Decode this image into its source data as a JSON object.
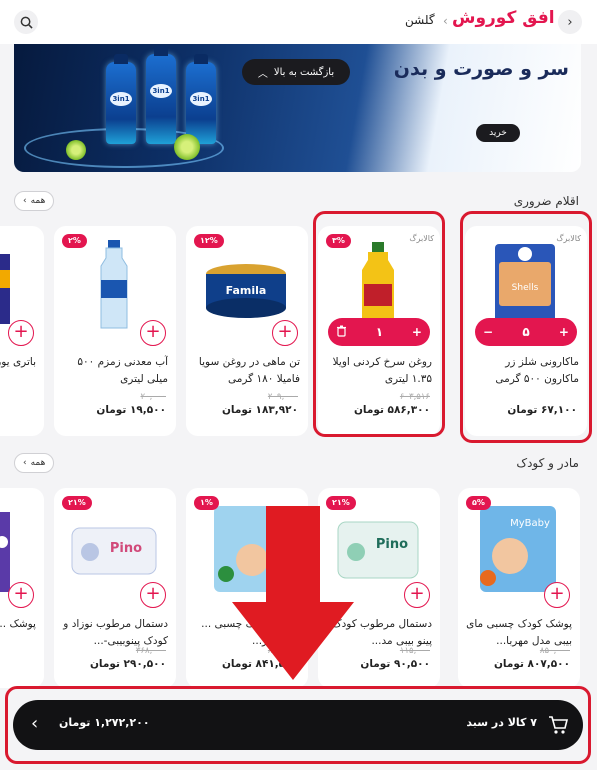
{
  "header": {
    "logo": "افق کوروش",
    "separator": "‹",
    "branch": "گلشن"
  },
  "banner": {
    "headline": "سر و صورت و بدن",
    "back_to_top": "بازگشت به بالا",
    "buy_label": "خرید",
    "bottle_label": "3in1"
  },
  "sections": [
    {
      "title": "اقلام ضروری",
      "all_label": "همه",
      "products": [
        {
          "tag": "کالابرگ",
          "discount": "",
          "name": "ماکارونی شلز زر ماکارون ۵۰۰ گرمی",
          "old_price": "",
          "price": "۶۷,۱۰۰ تومان",
          "qty": "۵",
          "in_cart": true
        },
        {
          "tag": "کالابرگ",
          "discount": "۳%",
          "name": "روغن سرخ کردنی اویلا ۱.۳۵ لیتری",
          "old_price": "۶۰۳,۵۱۶",
          "price": "۵۸۶,۳۰۰ تومان",
          "qty": "۱",
          "in_cart": true
        },
        {
          "tag": "",
          "discount": "۱۲%",
          "name": "تن ماهی در روغن سویا فامیلا ۱۸۰ گرمی",
          "old_price": "۲۰۹,۰۰۰",
          "price": "۱۸۳,۹۲۰ تومان",
          "qty": "",
          "in_cart": false
        },
        {
          "tag": "",
          "discount": "۲%",
          "name": "آب معدنی زمزم ۵۰۰ میلی لیتری",
          "old_price": "۲۰,۰۰۰",
          "price": "۱۹,۵۰۰ تومان",
          "qty": "",
          "in_cart": false
        },
        {
          "tag": "",
          "discount": "",
          "name": "باتری یوروس",
          "old_price": "",
          "price": "",
          "qty": "",
          "in_cart": false
        }
      ]
    },
    {
      "title": "مادر و کودک",
      "all_label": "همه",
      "products": [
        {
          "tag": "",
          "discount": "۵%",
          "name": "پوشک کودک چسبی مای بیبی مدل مهربا...",
          "old_price": "۸۵۰,۰۰۰",
          "price": "۸۰۷,۵۰۰ تومان",
          "qty": "",
          "in_cart": false
        },
        {
          "tag": "",
          "discount": "۲۱%",
          "name": "دستمال مرطوب کودک پینو بیبی مد...",
          "old_price": "۱۱۵,۰۰۰",
          "price": "۹۰,۵۰۰ تومان",
          "qty": "",
          "in_cart": false
        },
        {
          "tag": "",
          "discount": "۱%",
          "name": "پوشک کودک چسبی ... کانال دار...",
          "old_price": "۸۵۰,۰۰۰",
          "price": "۸۴۱,۵۰۰ تومان",
          "qty": "",
          "in_cart": false
        },
        {
          "tag": "",
          "discount": "۲۱%",
          "name": "دستمال مرطوب نوزاد و کودک پینوبیبی-...",
          "old_price": "۳۶۸,۰۰۰",
          "price": "۲۹۰,۵۰۰ تومان",
          "qty": "",
          "in_cart": false
        },
        {
          "tag": "",
          "discount": "",
          "name": "پوشک ... مای بی...",
          "old_price": "",
          "price": "",
          "qty": "",
          "in_cart": false
        }
      ]
    }
  ],
  "cart": {
    "count_label": "۷ کالا در سبد",
    "total_label": "۱,۲۷۲,۲۰۰ تومان"
  },
  "colors": {
    "accent": "#e3164f",
    "highlight": "#d9192f",
    "cartbar": "#121214"
  }
}
